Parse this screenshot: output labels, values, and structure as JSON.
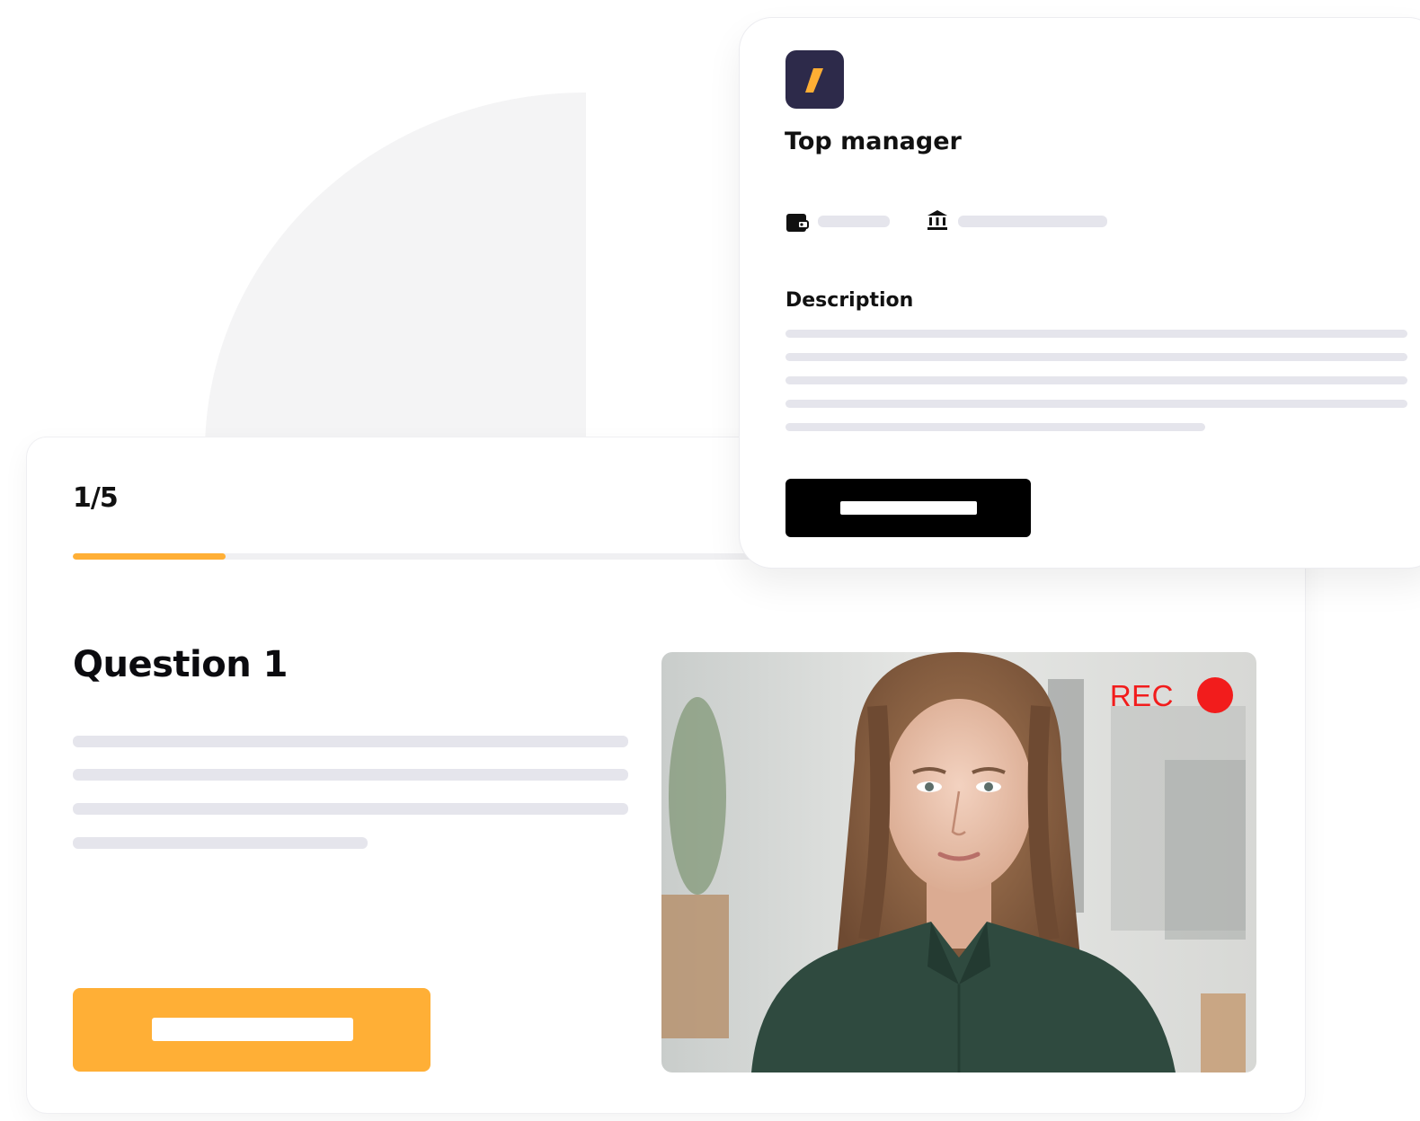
{
  "question_card": {
    "progress": {
      "label": "1/5",
      "fill_fraction": 0.125,
      "fill_color": "#ffaf36"
    },
    "title": "Question 1",
    "primary_button_color": "#ffaf36"
  },
  "video": {
    "rec_label": "REC",
    "rec_color": "#f21c1c"
  },
  "job_card": {
    "logo_icon": "slash-logo-icon",
    "title": "Top manager",
    "meta_icons": [
      "wallet-icon",
      "bank-icon"
    ],
    "description_heading": "Description",
    "button_color": "#000000"
  }
}
